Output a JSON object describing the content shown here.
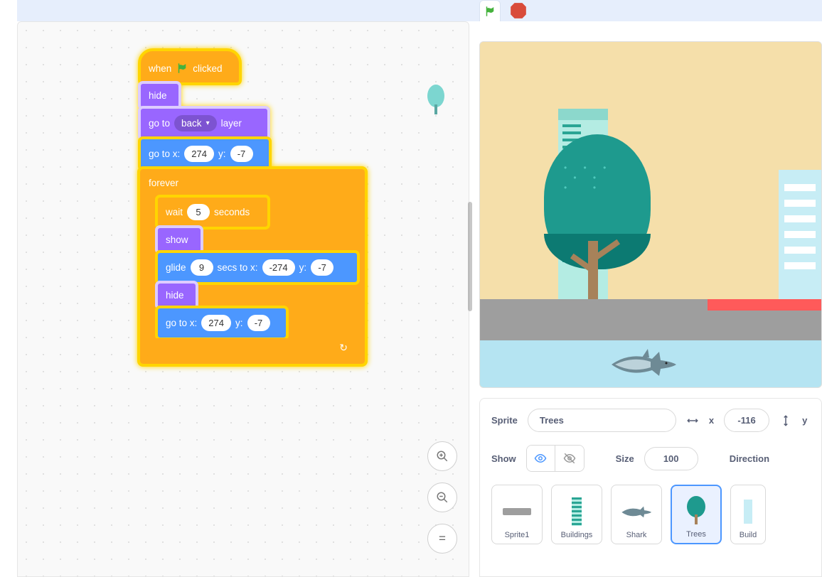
{
  "blocks": {
    "hat_when": "when",
    "hat_clicked": "clicked",
    "hide": "hide",
    "goto_layer_prefix": "go to",
    "goto_layer_dropdown": "back",
    "goto_layer_suffix": "layer",
    "gotoxy_prefix": "go to x:",
    "gotoxy_x": "274",
    "gotoxy_mid": "y:",
    "gotoxy_y": "-7",
    "forever": "forever",
    "wait_prefix": "wait",
    "wait_secs": "5",
    "wait_suffix": "seconds",
    "show": "show",
    "glide_prefix": "glide",
    "glide_secs": "9",
    "glide_mid1": "secs to x:",
    "glide_x": "-274",
    "glide_mid2": "y:",
    "glide_y": "-7",
    "hide2": "hide",
    "gotoxy2_prefix": "go to x:",
    "gotoxy2_x": "274",
    "gotoxy2_mid": "y:",
    "gotoxy2_y": "-7"
  },
  "zoom": {
    "in": "+",
    "out": "−",
    "reset": "="
  },
  "sprite_panel": {
    "sprite_label": "Sprite",
    "sprite_name": "Trees",
    "x_label": "x",
    "x_value": "-116",
    "y_label": "y",
    "show_label": "Show",
    "size_label": "Size",
    "size_value": "100",
    "direction_label": "Direction"
  },
  "sprites": {
    "s1": "Sprite1",
    "s2": "Buildings",
    "s3": "Shark",
    "s4": "Trees",
    "s5": "Build"
  },
  "colors": {
    "events": "#ffab19",
    "looks": "#9966ff",
    "motion": "#4c97ff",
    "control": "#ffab19",
    "glow": "#ffd500"
  }
}
